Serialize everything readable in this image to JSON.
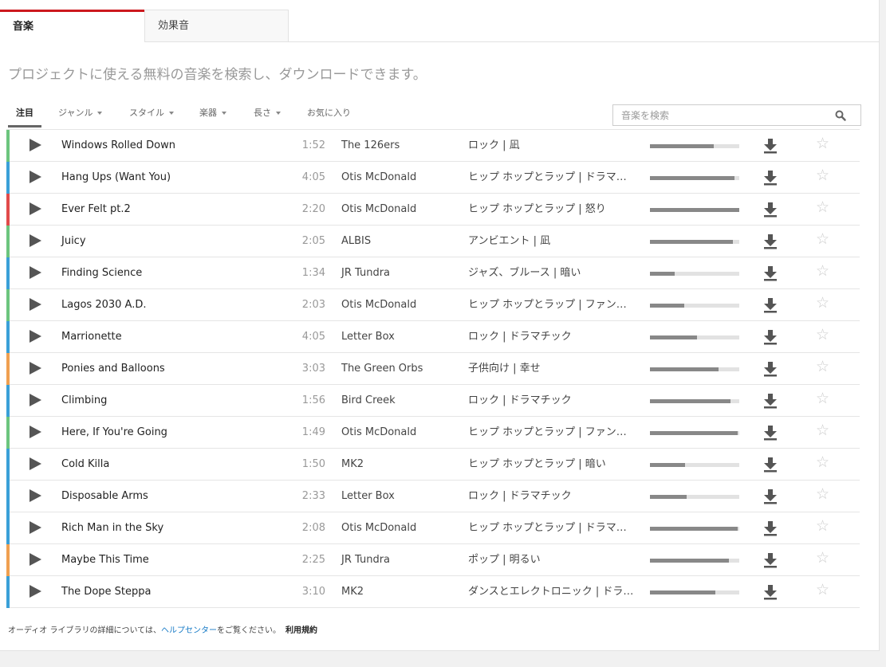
{
  "tabs": {
    "music": "音楽",
    "sfx": "効果音"
  },
  "subtitle": "プロジェクトに使える無料の音楽を検索し、ダウンロードできます。",
  "filters": {
    "featured": "注目",
    "genre": "ジャンル",
    "style": "スタイル",
    "instrument": "楽器",
    "length": "長さ",
    "favorites": "お気に入り"
  },
  "search": {
    "placeholder": "音楽を検索"
  },
  "tracks": [
    {
      "title": "Windows Rolled Down",
      "duration": "1:52",
      "artist": "The 126ers",
      "genre": "ロック | 凪",
      "color": "#6cc57e",
      "popularity": 0.71
    },
    {
      "title": "Hang Ups (Want You)",
      "duration": "4:05",
      "artist": "Otis McDonald",
      "genre": "ヒップ ホップとラップ | ドラマチック",
      "color": "#3aa0d8",
      "popularity": 0.95
    },
    {
      "title": "Ever Felt pt.2",
      "duration": "2:20",
      "artist": "Otis McDonald",
      "genre": "ヒップ ホップとラップ | 怒り",
      "color": "#e14b4b",
      "popularity": 1.0
    },
    {
      "title": "Juicy",
      "duration": "2:05",
      "artist": "ALBIS",
      "genre": "アンビエント | 凪",
      "color": "#6cc57e",
      "popularity": 0.93
    },
    {
      "title": "Finding Science",
      "duration": "1:34",
      "artist": "JR Tundra",
      "genre": "ジャズ、ブルース | 暗い",
      "color": "#3aa0d8",
      "popularity": 0.28
    },
    {
      "title": "Lagos 2030 A.D.",
      "duration": "2:03",
      "artist": "Otis McDonald",
      "genre": "ヒップ ホップとラップ | ファンキー",
      "color": "#6cc57e",
      "popularity": 0.38
    },
    {
      "title": "Marrionette",
      "duration": "4:05",
      "artist": "Letter Box",
      "genre": "ロック | ドラマチック",
      "color": "#3aa0d8",
      "popularity": 0.53
    },
    {
      "title": "Ponies and Balloons",
      "duration": "3:03",
      "artist": "The Green Orbs",
      "genre": "子供向け | 幸せ",
      "color": "#f0a050",
      "popularity": 0.77
    },
    {
      "title": "Climbing",
      "duration": "1:56",
      "artist": "Bird Creek",
      "genre": "ロック | ドラマチック",
      "color": "#3aa0d8",
      "popularity": 0.9
    },
    {
      "title": "Here, If You're Going",
      "duration": "1:49",
      "artist": "Otis McDonald",
      "genre": "ヒップ ホップとラップ | ファンキー",
      "color": "#6cc57e",
      "popularity": 0.98
    },
    {
      "title": "Cold Killa",
      "duration": "1:50",
      "artist": "MK2",
      "genre": "ヒップ ホップとラップ | 暗い",
      "color": "#3aa0d8",
      "popularity": 0.39
    },
    {
      "title": "Disposable Arms",
      "duration": "2:33",
      "artist": "Letter Box",
      "genre": "ロック | ドラマチック",
      "color": "#3aa0d8",
      "popularity": 0.41
    },
    {
      "title": "Rich Man in the Sky",
      "duration": "2:08",
      "artist": "Otis McDonald",
      "genre": "ヒップ ホップとラップ | ドラマチック",
      "color": "#3aa0d8",
      "popularity": 0.98
    },
    {
      "title": "Maybe This Time",
      "duration": "2:25",
      "artist": "JR Tundra",
      "genre": "ポップ | 明るい",
      "color": "#f0a050",
      "popularity": 0.88
    },
    {
      "title": "The Dope Steppa",
      "duration": "3:10",
      "artist": "MK2",
      "genre": "ダンスとエレクトロニック | ドラマチック",
      "color": "#3aa0d8",
      "popularity": 0.73
    }
  ],
  "footer": {
    "prefix": "オーディオ ライブラリの詳細については、",
    "link": "ヘルプセンター",
    "suffix": "をご覧ください。",
    "terms": "利用規約"
  }
}
